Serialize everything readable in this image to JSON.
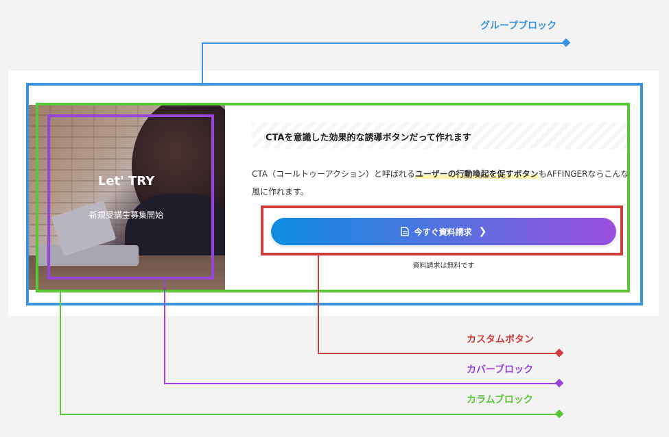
{
  "labels": {
    "group_block": "グループブロック",
    "custom_button": "カスタムボタン",
    "cover_block": "カバーブロック",
    "column_block": "カラムブロック"
  },
  "cover": {
    "title": "Let' TRY",
    "subtitle": "新規受講生募集開始"
  },
  "cta": {
    "heading": "CTAを意識した効果的な誘導ボタンだって作れます",
    "text_before": "CTA（コールトゥーアクション）と呼ばれる",
    "text_emphasis": "ユーザーの行動喚起を促すボタン",
    "text_after": "もAFFINGERならこんな風に作れます。",
    "button_label": "今すぐ資料請求",
    "button_icon": "document-icon",
    "note": "資料請求は無料です"
  },
  "colors": {
    "group": "#3a94e2",
    "column": "#5bc637",
    "cover": "#9646dd",
    "button": "#d03c3c"
  }
}
